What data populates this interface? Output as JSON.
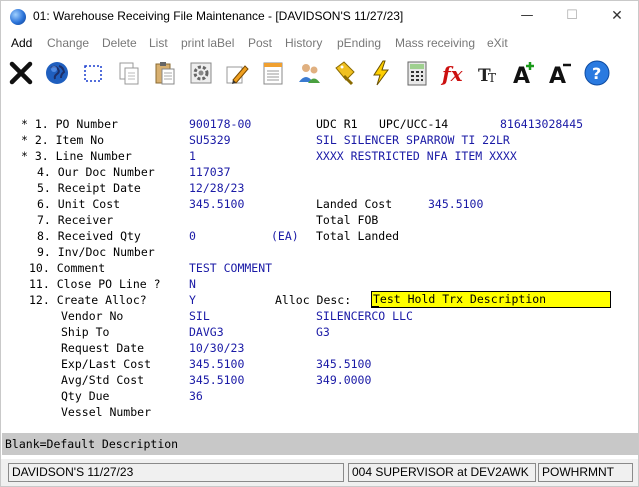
{
  "window": {
    "title": "01: Warehouse Receiving File Maintenance - [DAVIDSON'S 11/27/23]",
    "minimize": "—",
    "maximize": "☐",
    "close": "✕"
  },
  "menu": [
    {
      "label": "Add",
      "active": true
    },
    {
      "label": "Change"
    },
    {
      "label": "Delete"
    },
    {
      "label": "List"
    },
    {
      "label": "print laBel"
    },
    {
      "label": "Post"
    },
    {
      "label": "History"
    },
    {
      "label": "pEnding"
    },
    {
      "label": "Mass receiving"
    },
    {
      "label": "eXit"
    }
  ],
  "toolbar_icons": [
    "exit-x-icon",
    "globe-icon",
    "select-box-icon",
    "copy-icon",
    "paste-icon",
    "settings-gear-icon",
    "edit-pencil-icon",
    "notepad-icon",
    "users-icon",
    "tag-chain-icon",
    "lightning-icon",
    "calculator-icon",
    "function-fx-icon",
    "font-tt-icon",
    "font-increase-icon",
    "font-decrease-icon",
    "help-icon"
  ],
  "fields": {
    "r1": {
      "label": "* 1. PO Number",
      "value": "900178-00",
      "x2label": "UDC R1",
      "x3label": "UPC/UCC-14",
      "x3value": "816413028445"
    },
    "r2": {
      "label": "* 2. Item No",
      "value": "SU5329",
      "desc": "SIL SILENCER SPARROW TI 22LR"
    },
    "r3": {
      "label": "* 3. Line Number",
      "value": "1",
      "desc": "XXXX RESTRICTED NFA ITEM XXXX"
    },
    "r4": {
      "label": "4. Our Doc Number",
      "value": "117037"
    },
    "r5": {
      "label": "5. Receipt Date",
      "value": "12/28/23"
    },
    "r6": {
      "label": "6. Unit Cost",
      "value": "345.5100",
      "x2label": "Landed Cost",
      "x2value": "345.5100"
    },
    "r7": {
      "label": "7. Receiver",
      "x2label": "Total FOB"
    },
    "r8": {
      "label": "8. Received Qty",
      "value": "0",
      "unit": "(EA)",
      "x2label": "Total Landed"
    },
    "r9": {
      "label": "9. Inv/Doc Number"
    },
    "r10": {
      "label": "10. Comment",
      "value": "TEST COMMENT"
    },
    "r11": {
      "label": "11. Close PO Line ?",
      "value": "N"
    },
    "r12": {
      "label": "12. Create Alloc?",
      "value": "Y",
      "x2label": "Alloc Desc:",
      "input_value": "Test Hold Trx Description"
    },
    "vendor": {
      "label": "Vendor No",
      "value": "SIL",
      "desc": "SILENCERCO LLC"
    },
    "shipto": {
      "label": "Ship To",
      "value": "DAVG3",
      "desc": "G3"
    },
    "request": {
      "label": "Request Date",
      "value": "10/30/23"
    },
    "explast": {
      "label": "Exp/Last Cost",
      "value": "345.5100",
      "desc": "345.5100"
    },
    "avgstd": {
      "label": "Avg/Std Cost",
      "value": "345.5100",
      "desc": "349.0000"
    },
    "qtydue": {
      "label": "Qty Due",
      "value": "36"
    },
    "vessel": {
      "label": "Vessel Number"
    }
  },
  "helpbar": {
    "text": "Blank=Default Description"
  },
  "status": {
    "company": "DAVIDSON'S 11/27/23",
    "user": "004 SUPERVISOR at DEV2AWK",
    "program": "POWHRMNT"
  }
}
